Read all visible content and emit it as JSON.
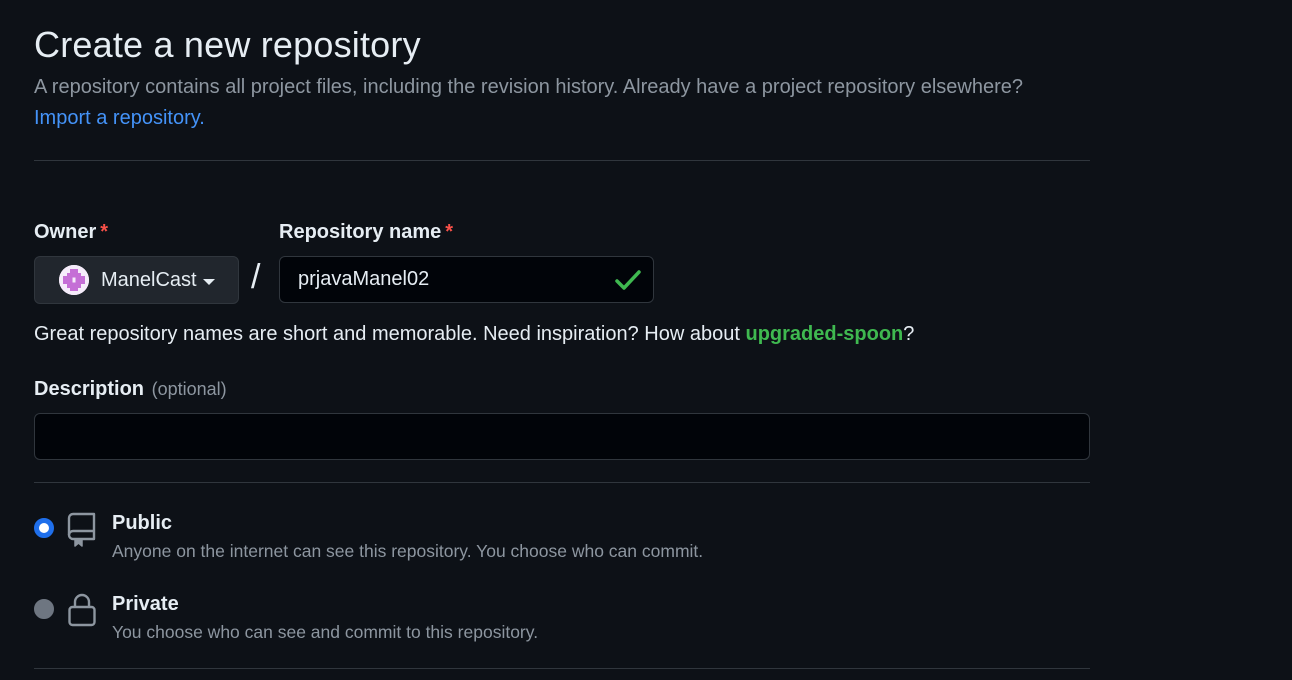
{
  "header": {
    "title": "Create a new repository",
    "subtitle": "A repository contains all project files, including the revision history. Already have a project repository elsewhere?",
    "import_link": "Import a repository."
  },
  "owner": {
    "label": "Owner",
    "required_mark": "*",
    "value": "ManelCast",
    "avatar_icon": "identicon-avatar",
    "dropdown_icon": "caret-down-icon"
  },
  "separator": "/",
  "repo_name": {
    "label": "Repository name",
    "required_mark": "*",
    "value": "prjavaManel02",
    "status_icon": "check-icon",
    "status_color": "#3fb950"
  },
  "name_hint": {
    "text": "Great repository names are short and memorable. Need inspiration? How about ",
    "suggestion": "upgraded-spoon",
    "suffix": "?"
  },
  "description": {
    "label": "Description",
    "optional_note": "(optional)",
    "value": ""
  },
  "visibility": {
    "selected": "Public",
    "options": [
      {
        "label": "Public",
        "description": "Anyone on the internet can see this repository. You choose who can commit.",
        "icon": "repo-icon",
        "checked": true
      },
      {
        "label": "Private",
        "description": "You choose who can see and commit to this repository.",
        "icon": "lock-icon",
        "checked": false
      }
    ]
  },
  "colors": {
    "background": "#0d1117",
    "accent": "#1f6feb",
    "link": "#4493f8",
    "success": "#3fb950",
    "danger": "#f85149"
  }
}
